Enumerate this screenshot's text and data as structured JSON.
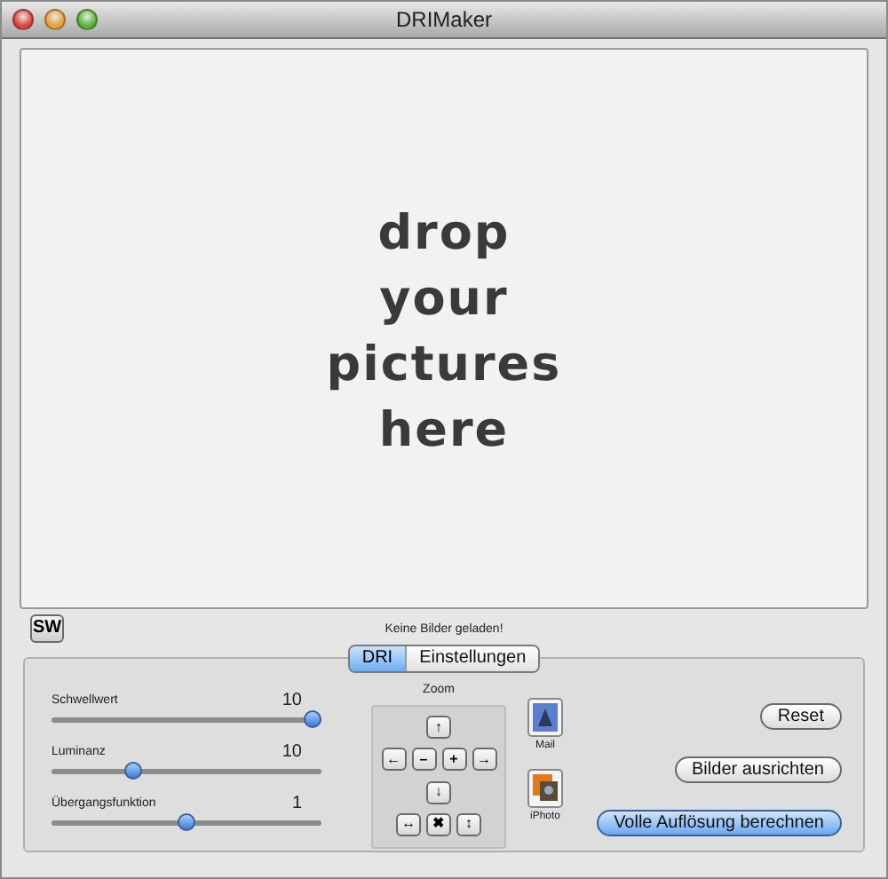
{
  "window": {
    "title": "DRIMaker"
  },
  "drop_area": {
    "lines": [
      "drop",
      "your",
      "pictures",
      "here"
    ]
  },
  "sw_button": {
    "label": "SW"
  },
  "status": "Keine Bilder geladen!",
  "tabs": [
    {
      "label": "DRI",
      "selected": true
    },
    {
      "label": "Einstellungen",
      "selected": false
    }
  ],
  "sliders": [
    {
      "label": "Schwellwert",
      "value": "10",
      "level": 0.97
    },
    {
      "label": "Luminanz",
      "value": "10",
      "level": 0.3
    },
    {
      "label": "Übergangsfunktion",
      "value": "1",
      "level": 0.5
    }
  ],
  "zoom": {
    "title": "Zoom",
    "keys": [
      {
        "label": "↑",
        "new_row": true
      },
      {
        "label": "←",
        "new_row": true
      },
      {
        "label": "–",
        "new_row": false
      },
      {
        "label": "+",
        "new_row": false
      },
      {
        "label": "→",
        "new_row": false
      },
      {
        "label": "↓",
        "new_row": true
      },
      {
        "label": "↔",
        "new_row": true
      },
      {
        "label": "✖",
        "new_row": false
      },
      {
        "label": "↕",
        "new_row": false
      }
    ]
  },
  "share": [
    {
      "kind": "mail",
      "label": "Mail"
    },
    {
      "kind": "iphoto",
      "label": "iPhoto"
    }
  ],
  "buttons": [
    {
      "label": "Reset",
      "default": false
    },
    {
      "label": "Bilder ausrichten",
      "default": false
    },
    {
      "label": "Volle Auflösung berechnen",
      "default": true
    }
  ]
}
